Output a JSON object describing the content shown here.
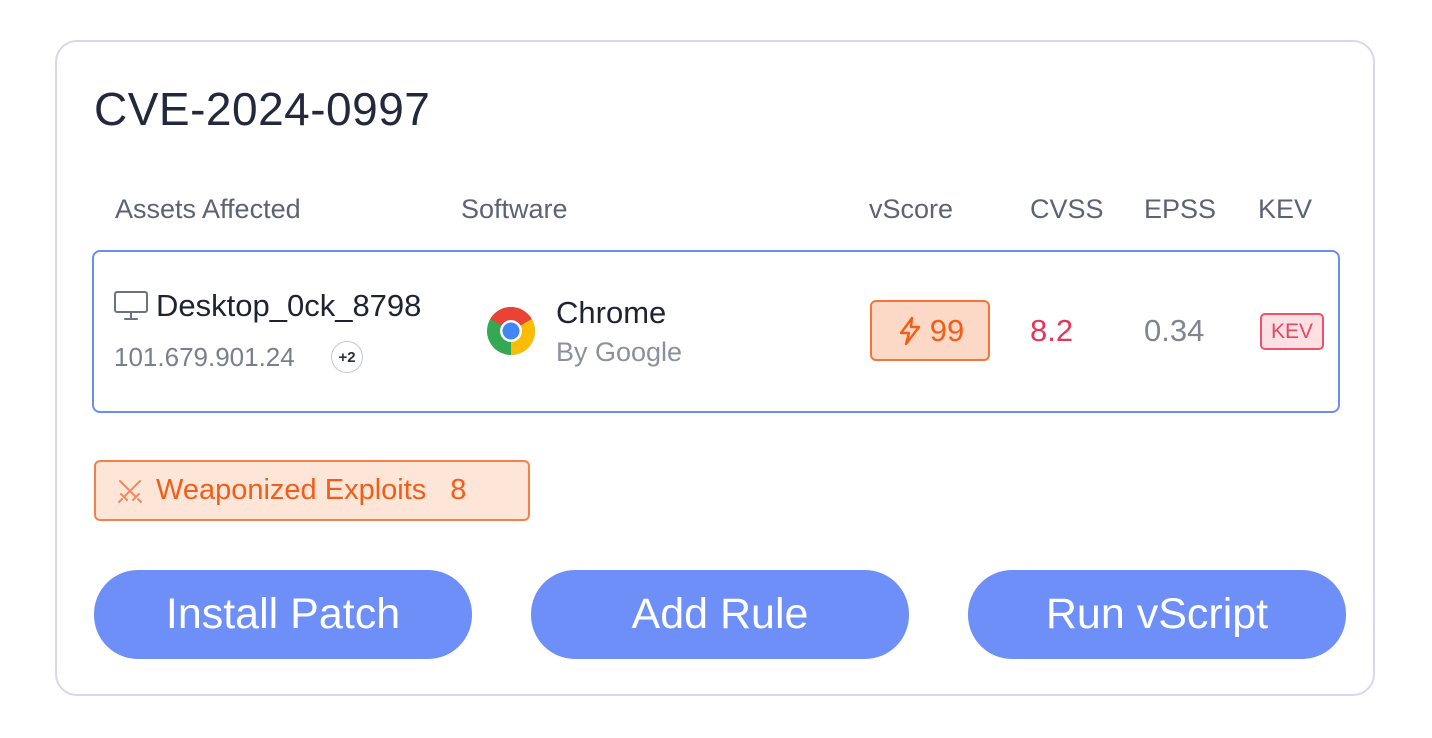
{
  "cve": {
    "id": "CVE-2024-0997"
  },
  "columns": {
    "assets": "Assets Affected",
    "software": "Software",
    "vscore": "vScore",
    "cvss": "CVSS",
    "epss": "EPSS",
    "kev": "KEV"
  },
  "row": {
    "asset_name": "Desktop_0ck_8798",
    "asset_ip": "101.679.901.24",
    "asset_more": "+2",
    "software_name": "Chrome",
    "software_vendor": "By Google",
    "vscore": "99",
    "cvss": "8.2",
    "epss": "0.34",
    "kev": "KEV"
  },
  "exploits": {
    "label": "Weaponized Exploits",
    "count": "8"
  },
  "actions": {
    "install_patch": "Install Patch",
    "add_rule": "Add Rule",
    "run_vscript": "Run vScript"
  },
  "icons": {
    "asset": "desktop-monitor-icon",
    "software": "chrome-logo-icon",
    "vscore": "lightning-bolt-icon",
    "exploits": "crossed-swords-icon"
  },
  "colors": {
    "accent": "#6d8ff7",
    "row_border": "#6b8df2",
    "vscore_text": "#f25e18",
    "cvss_text": "#e8335b",
    "kev_text": "#e5475c"
  }
}
